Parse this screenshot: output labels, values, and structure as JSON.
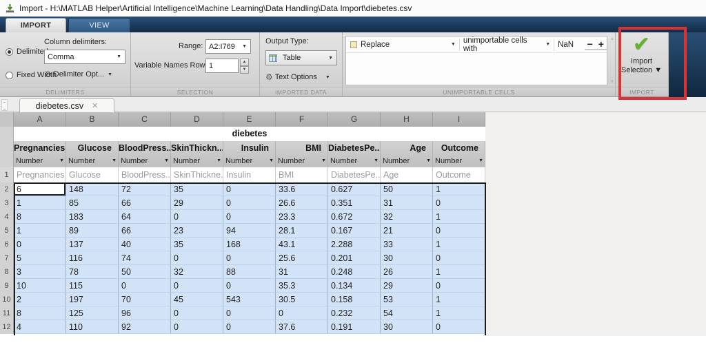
{
  "window": {
    "title": "Import - H:\\MATLAB Helper\\Artificial Intelligence\\Machine Learning\\Data Handling\\Data Import\\diebetes.csv"
  },
  "ribbon_tabs": {
    "import": "IMPORT",
    "view": "VIEW"
  },
  "delimiters": {
    "radio_delimited": "Delimited",
    "radio_fixed": "Fixed Width",
    "column_label": "Column delimiters:",
    "delimiter_value": "Comma",
    "options_button": "Delimiter Opt...",
    "footer": "DELIMITERS"
  },
  "selection": {
    "range_label": "Range:",
    "range_value": "A2:I769",
    "var_names_label": "Variable Names Row:",
    "var_names_value": "1",
    "footer": "SELECTION"
  },
  "imported_data": {
    "output_type_label": "Output Type:",
    "output_type_value": "Table",
    "text_options": "Text Options",
    "footer": "IMPORTED DATA"
  },
  "unimportable": {
    "rule_value": "Replace",
    "with_label": "unimportable cells with",
    "fill_value": "NaN",
    "minus": "−",
    "plus": "+",
    "footer": "UNIMPORTABLE CELLS"
  },
  "import_section": {
    "button_line1": "Import",
    "button_line2": "Selection ▼",
    "footer": "IMPORT"
  },
  "doc_tab": {
    "label": "diebetes.csv",
    "close": "✕"
  },
  "spreadsheet": {
    "title": "diebetes",
    "col_letters": [
      "A",
      "B",
      "C",
      "D",
      "E",
      "F",
      "G",
      "H",
      "I"
    ],
    "columns": [
      {
        "name": "Pregnancies",
        "type": "Number"
      },
      {
        "name": "Glucose",
        "type": "Number"
      },
      {
        "name": "BloodPress...",
        "type": "Number"
      },
      {
        "name": "SkinThickn...",
        "type": "Number"
      },
      {
        "name": "Insulin",
        "type": "Number"
      },
      {
        "name": "BMI",
        "type": "Number"
      },
      {
        "name": "DiabetesPe...",
        "type": "Number"
      },
      {
        "name": "Age",
        "type": "Number"
      },
      {
        "name": "Outcome",
        "type": "Number"
      }
    ],
    "header_row": {
      "number": "1",
      "values": [
        "Pregnancies",
        "Glucose",
        "BloodPress...",
        "SkinThickne...",
        "Insulin",
        "BMI",
        "DiabetesPe...",
        "Age",
        "Outcome"
      ]
    },
    "rows": [
      {
        "number": "2",
        "values": [
          "6",
          "148",
          "72",
          "35",
          "0",
          "33.6",
          "0.627",
          "50",
          "1"
        ]
      },
      {
        "number": "3",
        "values": [
          "1",
          "85",
          "66",
          "29",
          "0",
          "26.6",
          "0.351",
          "31",
          "0"
        ]
      },
      {
        "number": "4",
        "values": [
          "8",
          "183",
          "64",
          "0",
          "0",
          "23.3",
          "0.672",
          "32",
          "1"
        ]
      },
      {
        "number": "5",
        "values": [
          "1",
          "89",
          "66",
          "23",
          "94",
          "28.1",
          "0.167",
          "21",
          "0"
        ]
      },
      {
        "number": "6",
        "values": [
          "0",
          "137",
          "40",
          "35",
          "168",
          "43.1",
          "2.288",
          "33",
          "1"
        ]
      },
      {
        "number": "7",
        "values": [
          "5",
          "116",
          "74",
          "0",
          "0",
          "25.6",
          "0.201",
          "30",
          "0"
        ]
      },
      {
        "number": "8",
        "values": [
          "3",
          "78",
          "50",
          "32",
          "88",
          "31",
          "0.248",
          "26",
          "1"
        ]
      },
      {
        "number": "9",
        "values": [
          "10",
          "115",
          "0",
          "0",
          "0",
          "35.3",
          "0.134",
          "29",
          "0"
        ]
      },
      {
        "number": "10",
        "values": [
          "2",
          "197",
          "70",
          "45",
          "543",
          "30.5",
          "0.158",
          "53",
          "1"
        ]
      },
      {
        "number": "11",
        "values": [
          "8",
          "125",
          "96",
          "0",
          "0",
          "0",
          "0.232",
          "54",
          "1"
        ]
      },
      {
        "number": "12",
        "values": [
          "4",
          "110",
          "92",
          "0",
          "0",
          "37.6",
          "0.191",
          "30",
          "0"
        ]
      }
    ]
  },
  "colors": {
    "annotation_red": "#d93434",
    "selection_blue": "#d3e3f7",
    "check_green": "#63b22f"
  }
}
